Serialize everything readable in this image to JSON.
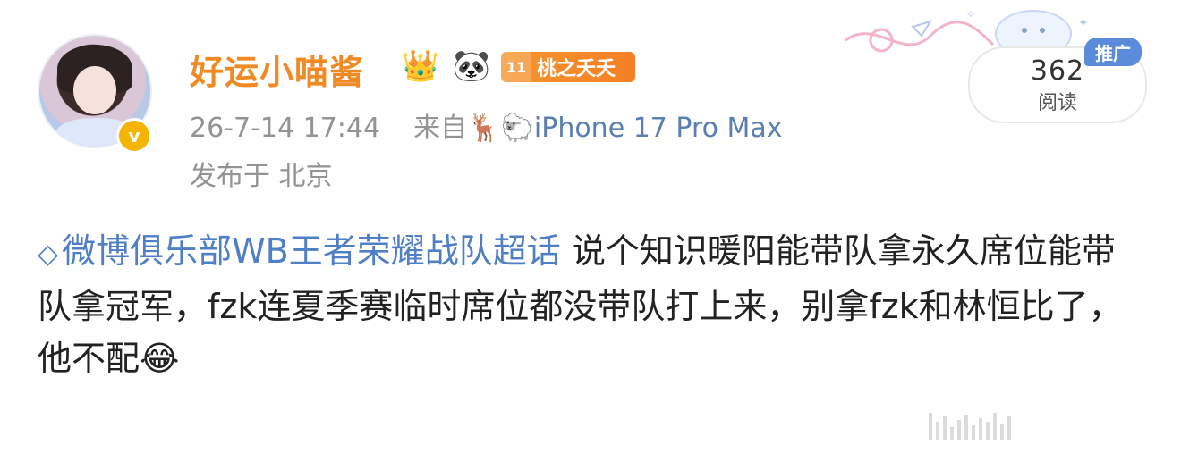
{
  "user": {
    "name": "好运小喵酱",
    "verified_mark": "v",
    "badges": {
      "crown": "👑",
      "panda": "🐼"
    },
    "fan_badge": {
      "level": "11",
      "label": "桃之夭夭"
    }
  },
  "meta": {
    "timestamp": "26-7-14 17:44",
    "source_prefix": "来自",
    "source_emojis": "🦌🐑",
    "device": "iPhone 17 Pro Max",
    "location": "发布于 北京"
  },
  "stats": {
    "read_count": "362",
    "read_label": "阅读",
    "promo_tag": "推广"
  },
  "post": {
    "supertopic_icon": "◇",
    "supertopic": "微博俱乐部WB王者荣耀战队超话",
    "text": " 说个知识暖阳能带队拿永久席位能带队拿冠军，fzk连夏季赛临时席位都没带队打上来，别拿fzk和林恒比了，他不配",
    "emoji": "😂"
  },
  "colors": {
    "username": "#f08a24",
    "link_blue": "#4f7fc4",
    "meta_gray": "#939393",
    "promo_blue": "#5b8cdc",
    "fan_badge_orange": "#f5962f"
  }
}
